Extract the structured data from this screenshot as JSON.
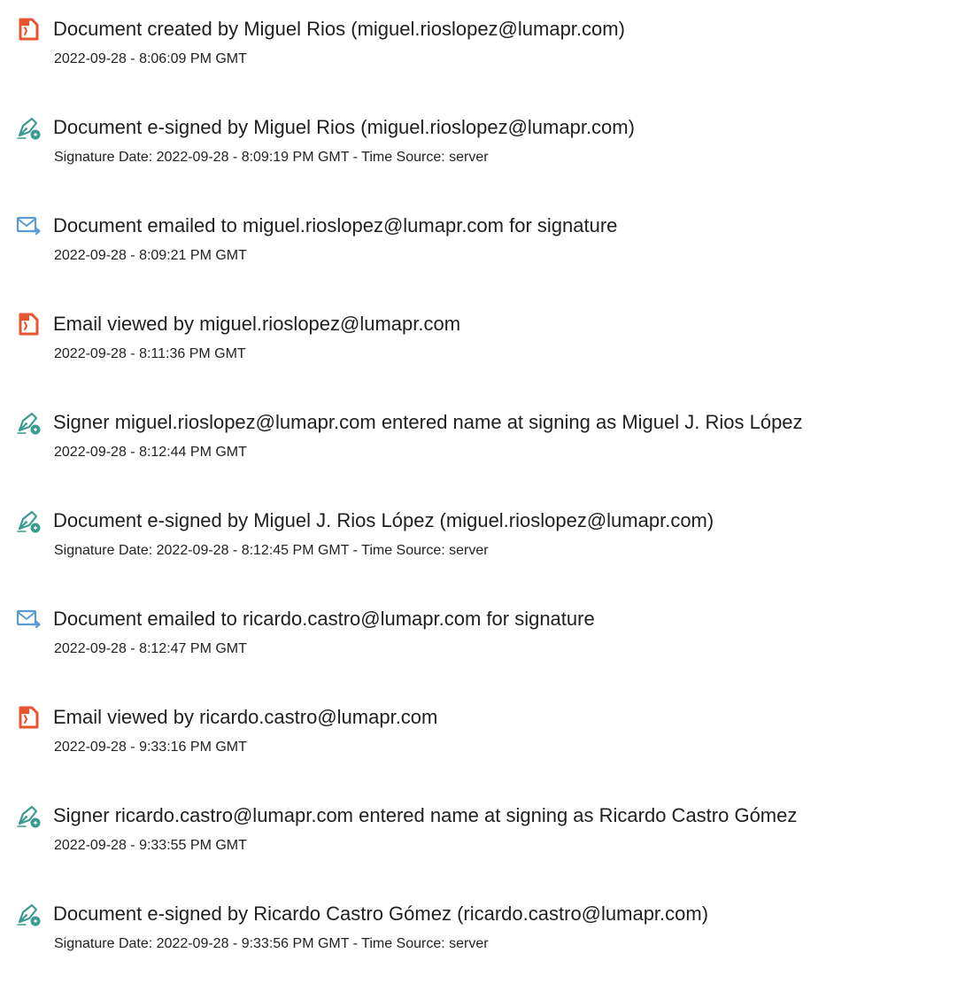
{
  "events": [
    {
      "icon": "document-created-icon",
      "title": "Document created by Miguel Rios (miguel.rioslopez@lumapr.com)",
      "detail": "2022-09-28 - 8:06:09 PM GMT"
    },
    {
      "icon": "e-sign-pen-icon",
      "title": "Document e-signed by Miguel Rios (miguel.rioslopez@lumapr.com)",
      "detail": "Signature Date: 2022-09-28 - 8:09:19 PM GMT - Time Source: server"
    },
    {
      "icon": "email-sent-icon",
      "title": "Document emailed to miguel.rioslopez@lumapr.com for signature",
      "detail": "2022-09-28 - 8:09:21 PM GMT"
    },
    {
      "icon": "document-viewed-icon",
      "title": "Email viewed by miguel.rioslopez@lumapr.com",
      "detail": "2022-09-28 - 8:11:36 PM GMT"
    },
    {
      "icon": "e-sign-pen-icon",
      "title": "Signer miguel.rioslopez@lumapr.com entered name at signing as Miguel J. Rios López",
      "detail": "2022-09-28 - 8:12:44 PM GMT"
    },
    {
      "icon": "e-sign-pen-icon",
      "title": "Document e-signed by Miguel J. Rios López (miguel.rioslopez@lumapr.com)",
      "detail": "Signature Date: 2022-09-28 - 8:12:45 PM GMT - Time Source: server"
    },
    {
      "icon": "email-sent-icon",
      "title": "Document emailed to ricardo.castro@lumapr.com for signature",
      "detail": "2022-09-28 - 8:12:47 PM GMT"
    },
    {
      "icon": "document-viewed-icon",
      "title": "Email viewed by ricardo.castro@lumapr.com",
      "detail": "2022-09-28 - 9:33:16 PM GMT"
    },
    {
      "icon": "e-sign-pen-icon",
      "title": "Signer ricardo.castro@lumapr.com entered name at signing as Ricardo Castro Gómez",
      "detail": "2022-09-28 - 9:33:55 PM GMT"
    },
    {
      "icon": "e-sign-pen-icon",
      "title": "Document e-signed by Ricardo Castro Gómez (ricardo.castro@lumapr.com)",
      "detail": "Signature Date: 2022-09-28 - 9:33:56 PM GMT - Time Source: server"
    }
  ],
  "colors": {
    "document_icon": "#e8542d",
    "pen_icon": "#3a9b8e",
    "email_icon": "#5b9bd5"
  }
}
